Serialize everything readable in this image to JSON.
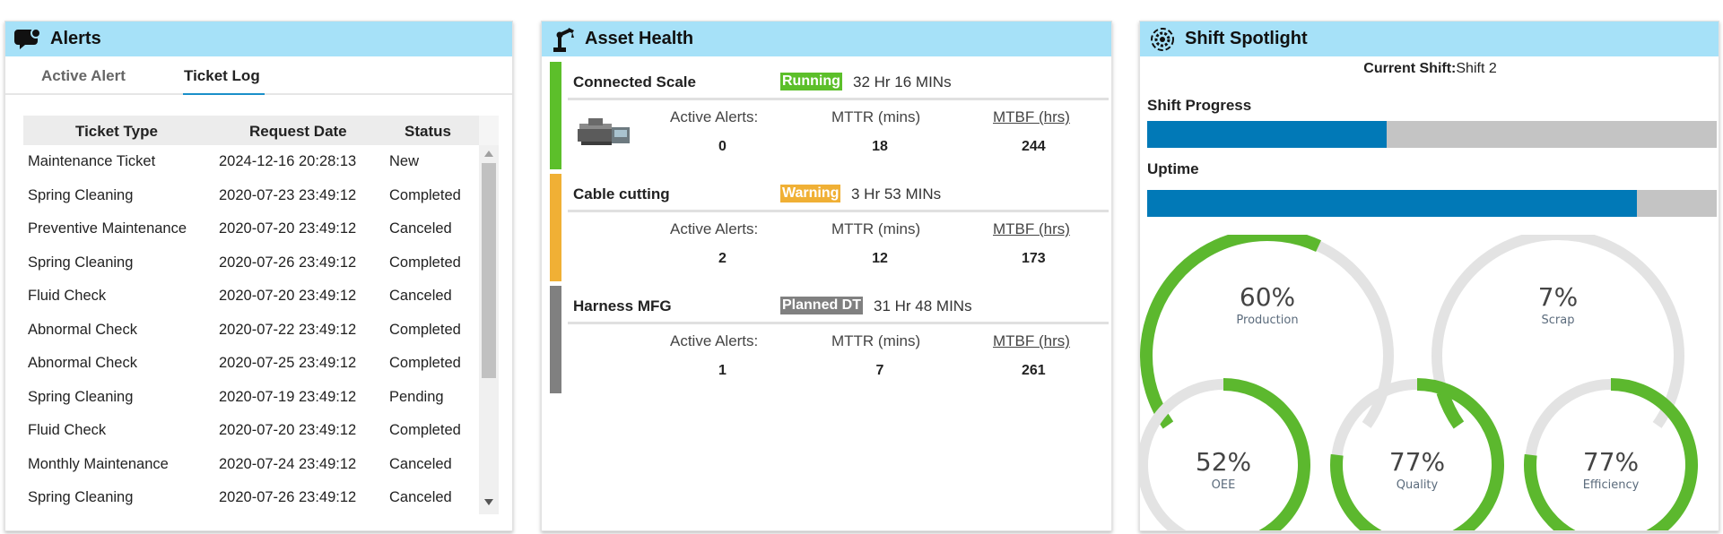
{
  "alerts": {
    "title": "Alerts",
    "tabs": [
      "Active Alert",
      "Ticket Log"
    ],
    "active_tab": "Ticket Log",
    "columns": [
      "Ticket Type",
      "Request Date",
      "Status"
    ],
    "rows": [
      [
        "Maintenance Ticket",
        "2024-12-16 20:28:13",
        "New"
      ],
      [
        "Spring Cleaning",
        "2020-07-23 23:49:12",
        "Completed"
      ],
      [
        "Preventive Maintenance",
        "2020-07-20 23:49:12",
        "Canceled"
      ],
      [
        "Spring Cleaning",
        "2020-07-26 23:49:12",
        "Completed"
      ],
      [
        "Fluid Check",
        "2020-07-20 23:49:12",
        "Canceled"
      ],
      [
        "Abnormal Check",
        "2020-07-22 23:49:12",
        "Completed"
      ],
      [
        "Abnormal Check",
        "2020-07-25 23:49:12",
        "Completed"
      ],
      [
        "Spring Cleaning",
        "2020-07-19 23:49:12",
        "Pending"
      ],
      [
        "Fluid Check",
        "2020-07-20 23:49:12",
        "Completed"
      ],
      [
        "Monthly Maintenance",
        "2020-07-24 23:49:12",
        "Canceled"
      ],
      [
        "Spring Cleaning",
        "2020-07-26 23:49:12",
        "Canceled"
      ]
    ]
  },
  "asset_health": {
    "title": "Asset Health",
    "metric_labels": [
      "Active Alerts:",
      "MTTR (mins)",
      "MTBF (hrs)"
    ],
    "assets": [
      {
        "name": "Connected Scale",
        "status": "Running",
        "status_color": "#5cbf2a",
        "duration": "32 Hr 16 MINs",
        "active_alerts": "0",
        "mttr": "18",
        "mtbf": "244"
      },
      {
        "name": "Cable cutting",
        "status": "Warning",
        "status_color": "#f0b035",
        "duration": "3 Hr 53 MINs",
        "active_alerts": "2",
        "mttr": "12",
        "mtbf": "173"
      },
      {
        "name": "Harness MFG",
        "status": "Planned DT",
        "status_color": "#808080",
        "duration": "31 Hr 48 MINs",
        "active_alerts": "1",
        "mttr": "7",
        "mtbf": "261"
      }
    ]
  },
  "shift": {
    "title": "Shift Spotlight",
    "current_shift_label": "Current Shift:",
    "current_shift_value": "Shift 2",
    "progress_label": "Shift Progress",
    "progress_fraction": 0.42,
    "uptime_label": "Uptime",
    "uptime_fraction": 0.86,
    "gauges": [
      {
        "pct": "60%",
        "label": "Production",
        "value": 60
      },
      {
        "pct": "7%",
        "label": "Scrap",
        "value": 7
      },
      {
        "pct": "52%",
        "label": "OEE",
        "value": 52
      },
      {
        "pct": "77%",
        "label": "Quality",
        "value": 77
      },
      {
        "pct": "77%",
        "label": "Efficiency",
        "value": 77
      }
    ],
    "accent_color": "#5cb82e",
    "progress_color": "#0179b7"
  }
}
